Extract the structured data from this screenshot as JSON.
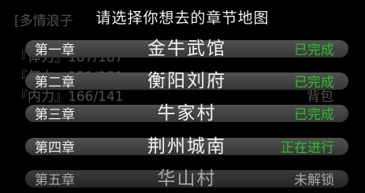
{
  "background": {
    "line1": "[多情浪子",
    "line2": "『体力』187/187",
    "line3": "『气血』251/251",
    "line4": "『内力』166/141",
    "bag": "背包"
  },
  "dialog": {
    "title": "请选择你想去的章节地图",
    "chapters": [
      {
        "chapter": "第一章",
        "name": "金牛武馆",
        "status": "已完成",
        "status_color": "#25c425"
      },
      {
        "chapter": "第二章",
        "name": "衡阳刘府",
        "status": "已完成",
        "status_color": "#25c425"
      },
      {
        "chapter": "第三章",
        "name": "牛家村",
        "status": "已完成",
        "status_color": "#25c425"
      },
      {
        "chapter": "第四章",
        "name": "荆州城南",
        "status": "正在进行",
        "status_color": "#25c425"
      },
      {
        "chapter": "第五章",
        "name": "华山村",
        "status": "未解锁",
        "status_color": "#a8a8a8"
      }
    ]
  }
}
